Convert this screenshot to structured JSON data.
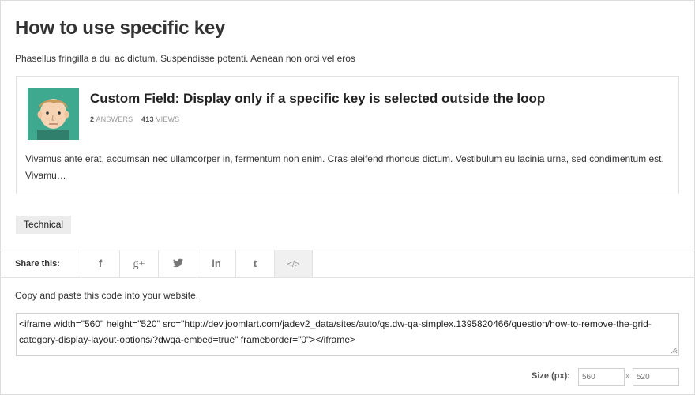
{
  "page": {
    "title": "How to use specific key",
    "intro": "Phasellus fringilla a dui ac dictum. Suspendisse potenti. Aenean non orci vel eros"
  },
  "question": {
    "title": "Custom Field: Display only if a specific key is selected outside the loop",
    "answers_count": "2",
    "answers_label": "ANSWERS",
    "views_count": "413",
    "views_label": "VIEWS",
    "excerpt": "Vivamus ante erat, accumsan nec ullamcorper in, fermentum non enim. Cras eleifend rhoncus dictum. Vestibulum eu lacinia urna, sed condimentum est. Vivamu…",
    "avatar_bg": "#3fa98f",
    "avatar_icon": "boy-avatar-icon"
  },
  "tag": {
    "label": "Technical"
  },
  "share": {
    "label": "Share this:",
    "buttons": [
      {
        "icon": "facebook-icon",
        "glyph": "f"
      },
      {
        "icon": "google-plus-icon",
        "glyph": "g+"
      },
      {
        "icon": "twitter-icon",
        "glyph": ""
      },
      {
        "icon": "linkedin-icon",
        "glyph": "in"
      },
      {
        "icon": "tumblr-icon",
        "glyph": "t"
      },
      {
        "icon": "embed-code-icon",
        "glyph": "</>"
      }
    ]
  },
  "embed": {
    "instructions": "Copy and paste this code into your website.",
    "code": "<iframe width=\"560\" height=\"520\" src=\"http://dev.joomlart.com/jadev2_data/sites/auto/qs.dw-qa-simplex.1395820466/question/how-to-remove-the-grid-category-display-layout-options/?dwqa-embed=true\" frameborder=\"0\"></iframe>"
  },
  "size": {
    "label": "Size (px):",
    "width_placeholder": "560",
    "height_placeholder": "520",
    "separator": "x"
  }
}
